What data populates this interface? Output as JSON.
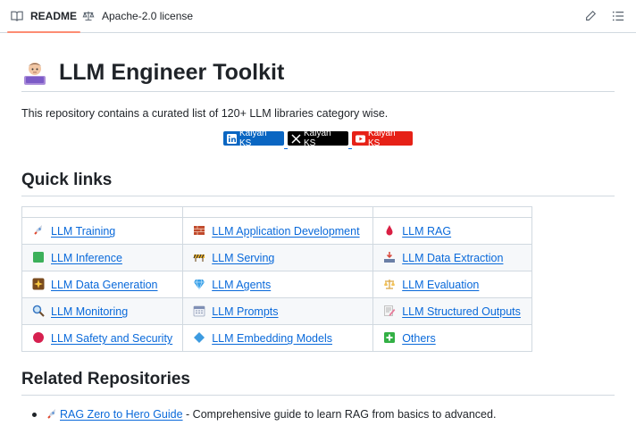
{
  "tabs": {
    "readme": "README",
    "license": "Apache-2.0 license"
  },
  "header_icons": [
    "pencil-icon",
    "list-icon"
  ],
  "title": "LLM Engineer Toolkit",
  "description": "This repository contains a curated list of 120+ LLM libraries category wise.",
  "badges": [
    {
      "platform": "linkedin",
      "label": "Kalyan KS",
      "color": "#0a66c2"
    },
    {
      "platform": "x",
      "label": "Kalyan KS",
      "color": "#000000"
    },
    {
      "platform": "youtube",
      "label": "Kalyan KS",
      "color": "#e62117"
    }
  ],
  "quick_links": {
    "heading": "Quick links",
    "rows": [
      [
        {
          "icon": "rocket-icon",
          "label": "LLM Training"
        },
        {
          "icon": "brick-icon",
          "label": "LLM Application Development"
        },
        {
          "icon": "drop-icon",
          "label": "LLM RAG"
        }
      ],
      [
        {
          "icon": "green-square-icon",
          "label": "LLM Inference"
        },
        {
          "icon": "barrier-icon",
          "label": "LLM Serving"
        },
        {
          "icon": "tray-icon",
          "label": "LLM Data Extraction"
        }
      ],
      [
        {
          "icon": "sparkle-icon",
          "label": "LLM Data Generation"
        },
        {
          "icon": "gem-icon",
          "label": "LLM Agents"
        },
        {
          "icon": "scale-icon",
          "label": "LLM Evaluation"
        }
      ],
      [
        {
          "icon": "magnifier-icon",
          "label": "LLM Monitoring"
        },
        {
          "icon": "calendar-icon",
          "label": "LLM Prompts"
        },
        {
          "icon": "memo-icon",
          "label": "LLM Structured Outputs"
        }
      ],
      [
        {
          "icon": "red-circle-icon",
          "label": "LLM Safety and Security"
        },
        {
          "icon": "diamond-icon",
          "label": "LLM Embedding Models"
        },
        {
          "icon": "plus-square-icon",
          "label": "Others"
        }
      ]
    ]
  },
  "related": {
    "heading": "Related Repositories",
    "items": [
      {
        "icon": "rocket-icon",
        "link": "RAG Zero to Hero Guide",
        "text": " - Comprehensive guide to learn RAG from basics to advanced."
      }
    ]
  }
}
